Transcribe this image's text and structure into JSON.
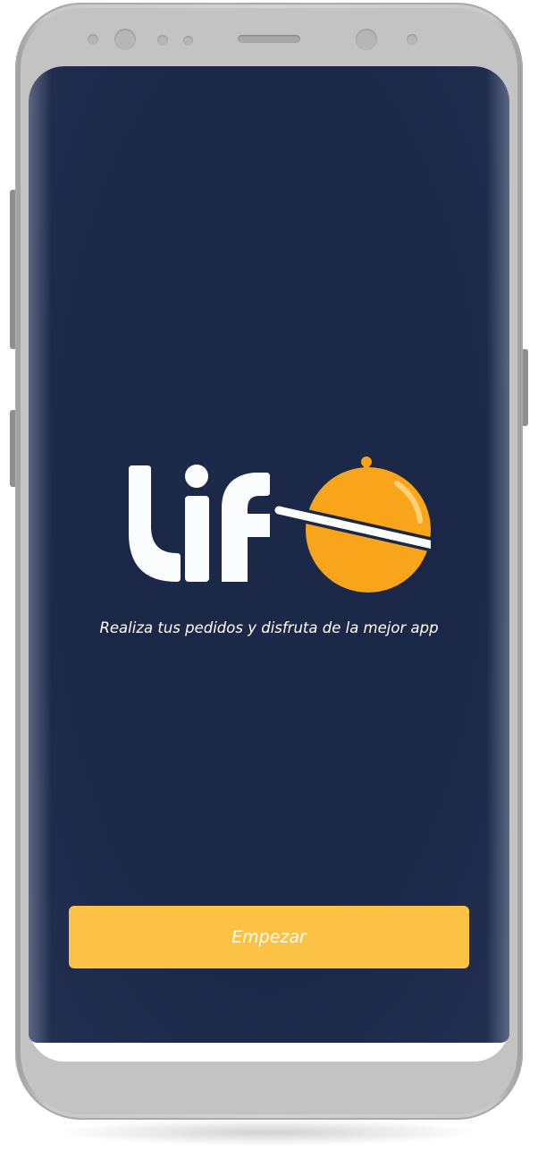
{
  "app": {
    "logo_text": "Lif",
    "tagline": "Realiza tus pedidos y disfruta de la mejor app",
    "start_button_label": "Empezar"
  },
  "device": {
    "type": "smartphone-mockup",
    "frame_color": "#c8c8c8"
  },
  "colors": {
    "background": "#1b2747",
    "accent": "#f9a51a",
    "button": "#fcc245",
    "text": "#ffffff"
  },
  "icons": {
    "logo_icon": "food-cloche-icon"
  }
}
